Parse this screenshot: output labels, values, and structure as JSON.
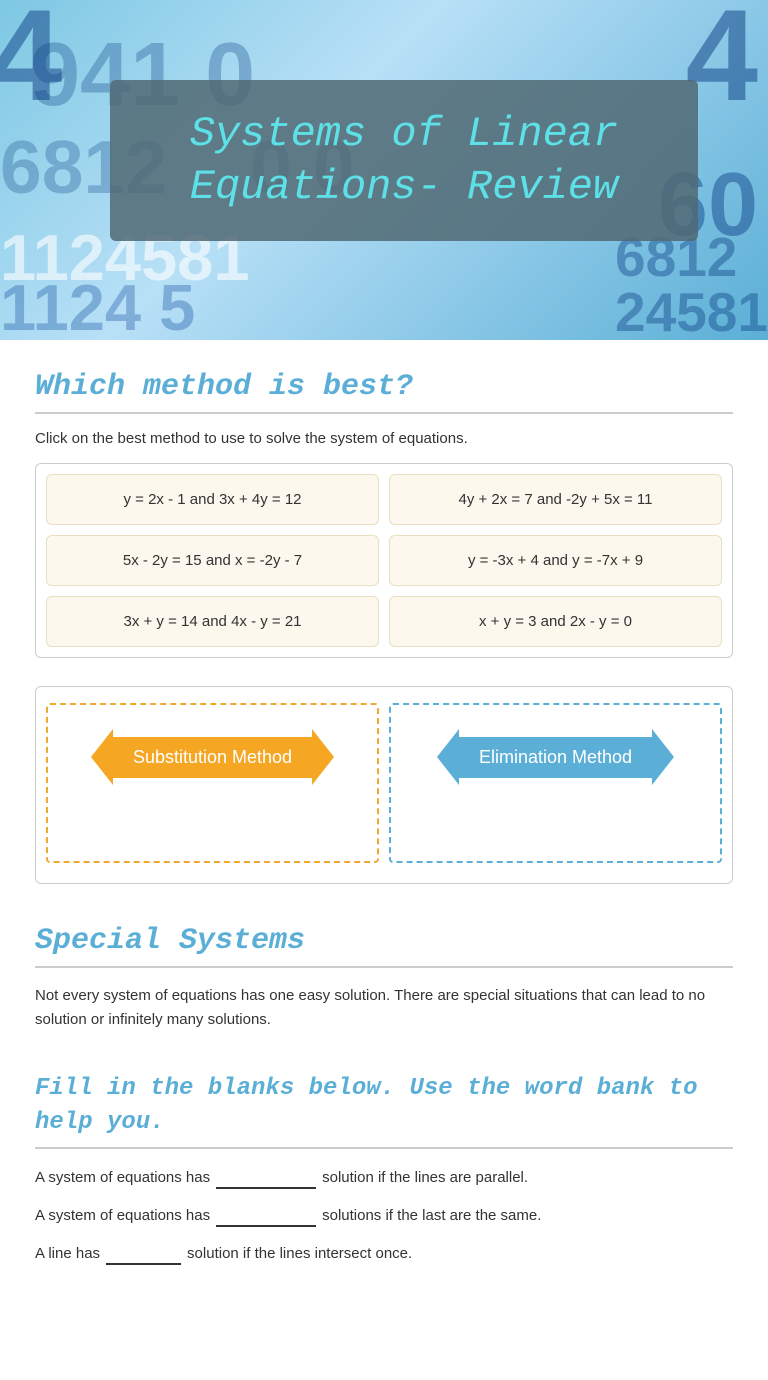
{
  "header": {
    "title": "Systems of Linear Equations- Review",
    "bottom_numbers": "1124581"
  },
  "which_method": {
    "heading": "Which method is best?",
    "instruction": "Click on the best method to use to solve the system of equations.",
    "equations": [
      "y = 2x - 1  and  3x + 4y = 12",
      "4y + 2x = 7  and  -2y + 5x = 11",
      "5x - 2y = 15  and  x = -2y - 7",
      "y = -3x + 4 and y = -7x + 9",
      "3x + y = 14  and  4x - y = 21",
      "x + y = 3  and  2x - y = 0"
    ]
  },
  "methods": {
    "substitution_label": "Substitution Method",
    "elimination_label": "Elimination Method"
  },
  "special_systems": {
    "heading": "Special Systems",
    "text": "Not every system of equations has one easy solution.  There are special situations that can lead to no solution or infinitely many solutions."
  },
  "fill_in_blanks": {
    "heading": "Fill in the blanks below. Use the word bank to help you.",
    "row1_before": "A system of equations has",
    "row1_after": "solution if the lines are parallel.",
    "row2_before": "A system of equations has",
    "row2_after": "solutions if the last are the same.",
    "row3_before": "A line has",
    "row3_after": "solution if the lines intersect once."
  }
}
